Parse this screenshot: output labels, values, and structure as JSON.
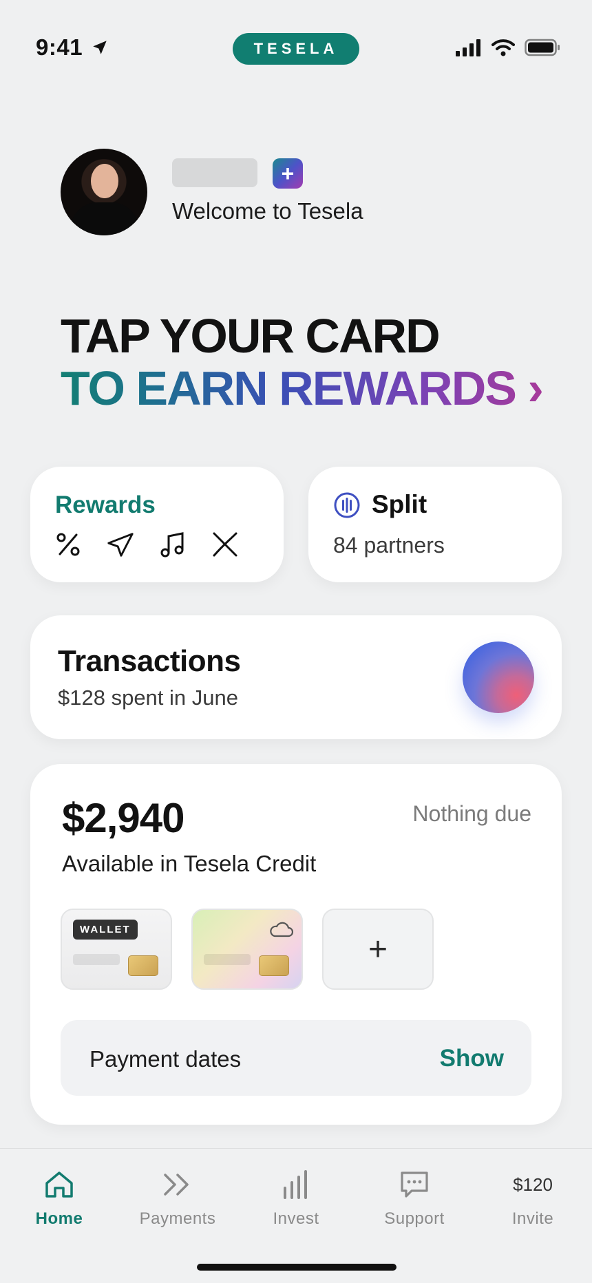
{
  "status_bar": {
    "time": "9:41",
    "brand_pill": "TESELA"
  },
  "profile": {
    "welcome": "Welcome to Tesela",
    "add_icon": "+"
  },
  "headline": {
    "line1": "TAP YOUR CARD",
    "line2": "TO EARN REWARDS",
    "chevron": "›"
  },
  "rewards_card": {
    "title": "Rewards",
    "icons": [
      "percent-icon",
      "paper-plane-icon",
      "music-note-icon",
      "crossed-lines-icon"
    ]
  },
  "split_card": {
    "title": "Split",
    "subtitle": "84 partners"
  },
  "transactions_card": {
    "title": "Transactions",
    "subtitle": "$128 spent in June"
  },
  "credit_card": {
    "amount": "$2,940",
    "due": "Nothing due",
    "available": "Available in Tesela Credit",
    "wallet_tag": "WALLET",
    "add_card": "+",
    "payment_dates": "Payment dates",
    "show": "Show"
  },
  "tabs": [
    {
      "label": "Home",
      "icon": "home-icon"
    },
    {
      "label": "Payments",
      "icon": "double-chevron-icon"
    },
    {
      "label": "Invest",
      "icon": "bar-chart-icon"
    },
    {
      "label": "Support",
      "icon": "chat-bubble-icon"
    },
    {
      "label": "Invite",
      "value": "$120"
    }
  ],
  "colors": {
    "accent": "#127b6f",
    "background": "#eff0f1"
  }
}
